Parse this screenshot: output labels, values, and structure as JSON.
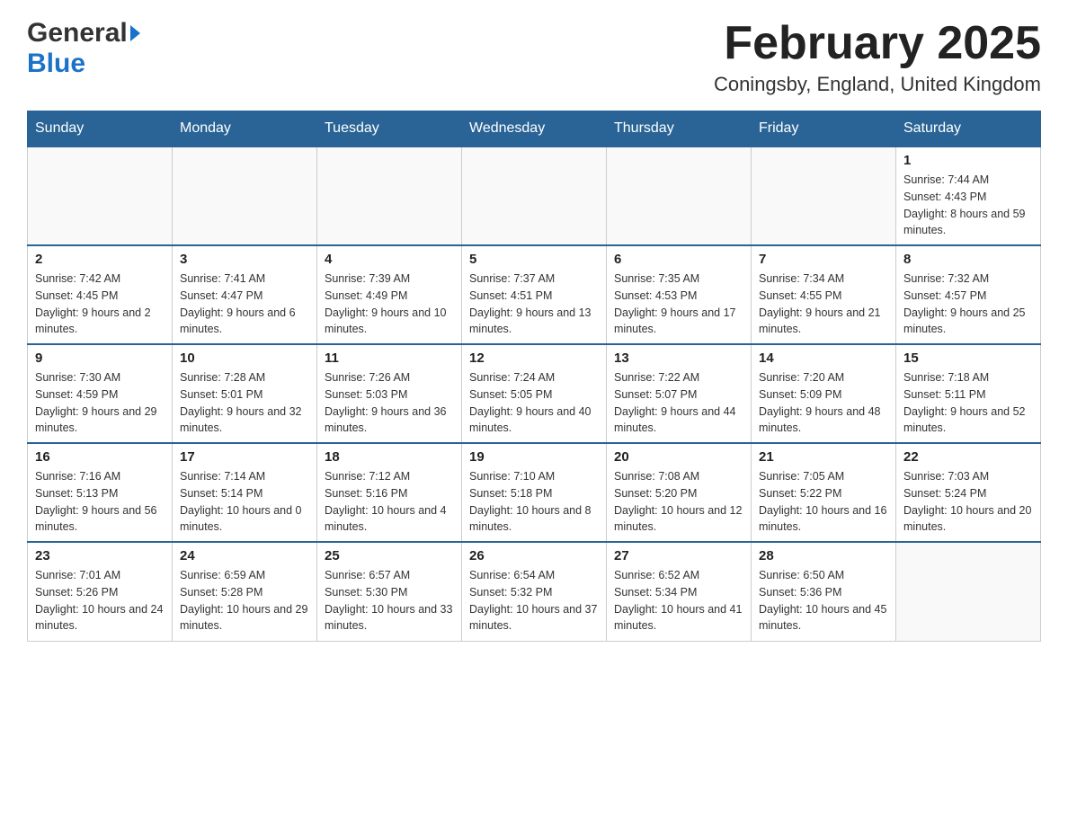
{
  "header": {
    "title": "February 2025",
    "subtitle": "Coningsby, England, United Kingdom",
    "logo_general": "General",
    "logo_blue": "Blue"
  },
  "days_of_week": [
    "Sunday",
    "Monday",
    "Tuesday",
    "Wednesday",
    "Thursday",
    "Friday",
    "Saturday"
  ],
  "weeks": [
    {
      "days": [
        {
          "num": "",
          "sunrise": "",
          "sunset": "",
          "daylight": "",
          "empty": true
        },
        {
          "num": "",
          "sunrise": "",
          "sunset": "",
          "daylight": "",
          "empty": true
        },
        {
          "num": "",
          "sunrise": "",
          "sunset": "",
          "daylight": "",
          "empty": true
        },
        {
          "num": "",
          "sunrise": "",
          "sunset": "",
          "daylight": "",
          "empty": true
        },
        {
          "num": "",
          "sunrise": "",
          "sunset": "",
          "daylight": "",
          "empty": true
        },
        {
          "num": "",
          "sunrise": "",
          "sunset": "",
          "daylight": "",
          "empty": true
        },
        {
          "num": "1",
          "sunrise": "Sunrise: 7:44 AM",
          "sunset": "Sunset: 4:43 PM",
          "daylight": "Daylight: 8 hours and 59 minutes.",
          "empty": false
        }
      ]
    },
    {
      "days": [
        {
          "num": "2",
          "sunrise": "Sunrise: 7:42 AM",
          "sunset": "Sunset: 4:45 PM",
          "daylight": "Daylight: 9 hours and 2 minutes.",
          "empty": false
        },
        {
          "num": "3",
          "sunrise": "Sunrise: 7:41 AM",
          "sunset": "Sunset: 4:47 PM",
          "daylight": "Daylight: 9 hours and 6 minutes.",
          "empty": false
        },
        {
          "num": "4",
          "sunrise": "Sunrise: 7:39 AM",
          "sunset": "Sunset: 4:49 PM",
          "daylight": "Daylight: 9 hours and 10 minutes.",
          "empty": false
        },
        {
          "num": "5",
          "sunrise": "Sunrise: 7:37 AM",
          "sunset": "Sunset: 4:51 PM",
          "daylight": "Daylight: 9 hours and 13 minutes.",
          "empty": false
        },
        {
          "num": "6",
          "sunrise": "Sunrise: 7:35 AM",
          "sunset": "Sunset: 4:53 PM",
          "daylight": "Daylight: 9 hours and 17 minutes.",
          "empty": false
        },
        {
          "num": "7",
          "sunrise": "Sunrise: 7:34 AM",
          "sunset": "Sunset: 4:55 PM",
          "daylight": "Daylight: 9 hours and 21 minutes.",
          "empty": false
        },
        {
          "num": "8",
          "sunrise": "Sunrise: 7:32 AM",
          "sunset": "Sunset: 4:57 PM",
          "daylight": "Daylight: 9 hours and 25 minutes.",
          "empty": false
        }
      ]
    },
    {
      "days": [
        {
          "num": "9",
          "sunrise": "Sunrise: 7:30 AM",
          "sunset": "Sunset: 4:59 PM",
          "daylight": "Daylight: 9 hours and 29 minutes.",
          "empty": false
        },
        {
          "num": "10",
          "sunrise": "Sunrise: 7:28 AM",
          "sunset": "Sunset: 5:01 PM",
          "daylight": "Daylight: 9 hours and 32 minutes.",
          "empty": false
        },
        {
          "num": "11",
          "sunrise": "Sunrise: 7:26 AM",
          "sunset": "Sunset: 5:03 PM",
          "daylight": "Daylight: 9 hours and 36 minutes.",
          "empty": false
        },
        {
          "num": "12",
          "sunrise": "Sunrise: 7:24 AM",
          "sunset": "Sunset: 5:05 PM",
          "daylight": "Daylight: 9 hours and 40 minutes.",
          "empty": false
        },
        {
          "num": "13",
          "sunrise": "Sunrise: 7:22 AM",
          "sunset": "Sunset: 5:07 PM",
          "daylight": "Daylight: 9 hours and 44 minutes.",
          "empty": false
        },
        {
          "num": "14",
          "sunrise": "Sunrise: 7:20 AM",
          "sunset": "Sunset: 5:09 PM",
          "daylight": "Daylight: 9 hours and 48 minutes.",
          "empty": false
        },
        {
          "num": "15",
          "sunrise": "Sunrise: 7:18 AM",
          "sunset": "Sunset: 5:11 PM",
          "daylight": "Daylight: 9 hours and 52 minutes.",
          "empty": false
        }
      ]
    },
    {
      "days": [
        {
          "num": "16",
          "sunrise": "Sunrise: 7:16 AM",
          "sunset": "Sunset: 5:13 PM",
          "daylight": "Daylight: 9 hours and 56 minutes.",
          "empty": false
        },
        {
          "num": "17",
          "sunrise": "Sunrise: 7:14 AM",
          "sunset": "Sunset: 5:14 PM",
          "daylight": "Daylight: 10 hours and 0 minutes.",
          "empty": false
        },
        {
          "num": "18",
          "sunrise": "Sunrise: 7:12 AM",
          "sunset": "Sunset: 5:16 PM",
          "daylight": "Daylight: 10 hours and 4 minutes.",
          "empty": false
        },
        {
          "num": "19",
          "sunrise": "Sunrise: 7:10 AM",
          "sunset": "Sunset: 5:18 PM",
          "daylight": "Daylight: 10 hours and 8 minutes.",
          "empty": false
        },
        {
          "num": "20",
          "sunrise": "Sunrise: 7:08 AM",
          "sunset": "Sunset: 5:20 PM",
          "daylight": "Daylight: 10 hours and 12 minutes.",
          "empty": false
        },
        {
          "num": "21",
          "sunrise": "Sunrise: 7:05 AM",
          "sunset": "Sunset: 5:22 PM",
          "daylight": "Daylight: 10 hours and 16 minutes.",
          "empty": false
        },
        {
          "num": "22",
          "sunrise": "Sunrise: 7:03 AM",
          "sunset": "Sunset: 5:24 PM",
          "daylight": "Daylight: 10 hours and 20 minutes.",
          "empty": false
        }
      ]
    },
    {
      "days": [
        {
          "num": "23",
          "sunrise": "Sunrise: 7:01 AM",
          "sunset": "Sunset: 5:26 PM",
          "daylight": "Daylight: 10 hours and 24 minutes.",
          "empty": false
        },
        {
          "num": "24",
          "sunrise": "Sunrise: 6:59 AM",
          "sunset": "Sunset: 5:28 PM",
          "daylight": "Daylight: 10 hours and 29 minutes.",
          "empty": false
        },
        {
          "num": "25",
          "sunrise": "Sunrise: 6:57 AM",
          "sunset": "Sunset: 5:30 PM",
          "daylight": "Daylight: 10 hours and 33 minutes.",
          "empty": false
        },
        {
          "num": "26",
          "sunrise": "Sunrise: 6:54 AM",
          "sunset": "Sunset: 5:32 PM",
          "daylight": "Daylight: 10 hours and 37 minutes.",
          "empty": false
        },
        {
          "num": "27",
          "sunrise": "Sunrise: 6:52 AM",
          "sunset": "Sunset: 5:34 PM",
          "daylight": "Daylight: 10 hours and 41 minutes.",
          "empty": false
        },
        {
          "num": "28",
          "sunrise": "Sunrise: 6:50 AM",
          "sunset": "Sunset: 5:36 PM",
          "daylight": "Daylight: 10 hours and 45 minutes.",
          "empty": false
        },
        {
          "num": "",
          "sunrise": "",
          "sunset": "",
          "daylight": "",
          "empty": true
        }
      ]
    }
  ]
}
